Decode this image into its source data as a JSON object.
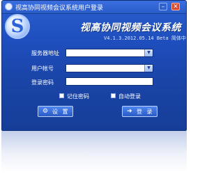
{
  "window": {
    "title": "视高协同视频会议系统用户登录",
    "minimize_glyph": "–",
    "close_glyph": "✕"
  },
  "header": {
    "logo_letter": "S",
    "app_title": "视高协同视频会议系统",
    "version": "V4.1.3.2012.05.14 Beta 简体中文版"
  },
  "form": {
    "server_label": "服务器地址",
    "server_value": "",
    "account_label": "用户帐号",
    "account_value": "",
    "password_label": "登录密码",
    "password_value": "",
    "remember_label": "记住密码",
    "remember_checked": false,
    "autologin_label": "自动登录",
    "autologin_checked": false
  },
  "buttons": {
    "settings_icon": "⚙",
    "settings_label": "设 置",
    "login_icon": "➜",
    "login_label": "登 录"
  },
  "icons": {
    "app": "app-logo-icon",
    "dropdown": "chevron-down-icon",
    "settings": "gear-icon",
    "login": "arrow-right-icon"
  },
  "colors": {
    "window_bg": "#1f4fbf",
    "titlebar": "#2a5cc9",
    "close": "#d9472f"
  }
}
